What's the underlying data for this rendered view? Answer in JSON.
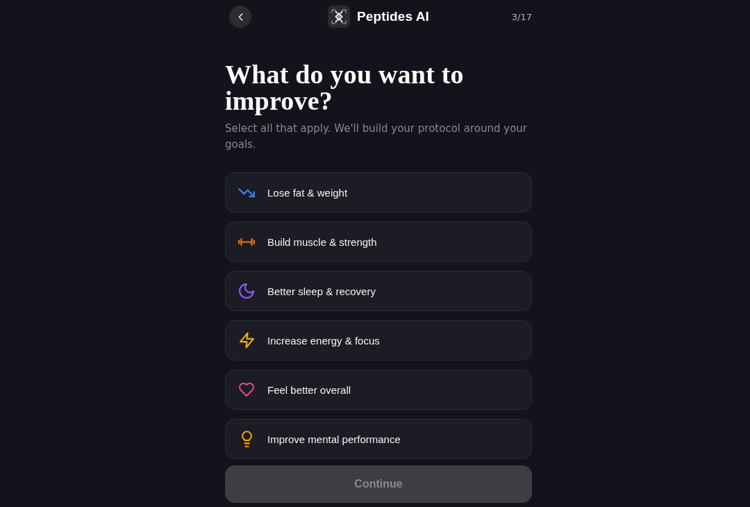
{
  "header": {
    "title": "Peptides AI",
    "step": "3/17"
  },
  "heading": "What do you want to improve?",
  "subtitle": "Select all that apply. We'll build your protocol around your goals.",
  "options": [
    {
      "label": "Lose fat & weight",
      "color": "#3b82f6",
      "selected": false
    },
    {
      "label": "Build muscle & strength",
      "color": "#f97316",
      "selected": false
    },
    {
      "label": "Better sleep & recovery",
      "color": "#8b5cf6",
      "selected": false
    },
    {
      "label": "Increase energy & focus",
      "color": "#eab308",
      "selected": false
    },
    {
      "label": "Feel better overall",
      "color": "#ec4899",
      "selected": false
    },
    {
      "label": "Improve mental performance",
      "color": "#f59e0b",
      "selected": false
    }
  ],
  "continue_button": {
    "label": "Continue",
    "disabled": true
  }
}
